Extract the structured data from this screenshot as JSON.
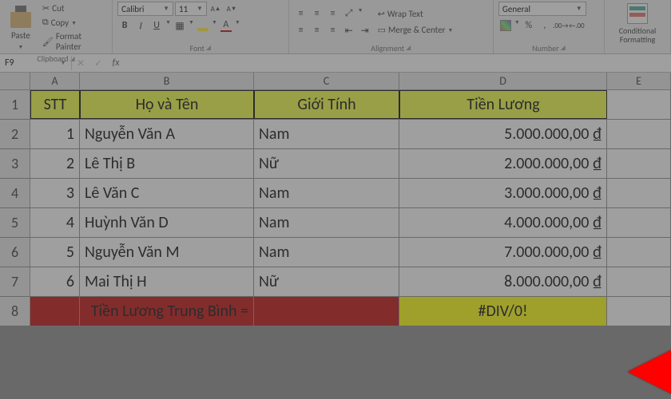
{
  "ribbon": {
    "clipboard": {
      "paste": "Paste",
      "cut": "Cut",
      "copy": "Copy",
      "painter": "Format Painter",
      "label": "Clipboard"
    },
    "font": {
      "name": "Calibri",
      "size": "11",
      "bold": "B",
      "italic": "I",
      "underline": "U",
      "fontcolor_letter": "A",
      "inc": "A▲",
      "dec": "A▼",
      "label": "Font"
    },
    "alignment": {
      "wrap": "Wrap Text",
      "merge": "Merge & Center",
      "label": "Alignment"
    },
    "number": {
      "format": "General",
      "pct": "%",
      "comma": ",",
      "label": "Number"
    },
    "styles": {
      "cf": "Conditional Formatting"
    }
  },
  "namebox": "F9",
  "fx": "fx",
  "formula": "",
  "columns": [
    "A",
    "B",
    "C",
    "D",
    "E"
  ],
  "headers": {
    "a": "STT",
    "b": "Họ và Tên",
    "c": "Giới Tính",
    "d": "Tiền Lương"
  },
  "rows": [
    {
      "n": "2",
      "a": "1",
      "b": "Nguyễn Văn A",
      "c": "Nam",
      "d": "5.000.000,00 ₫"
    },
    {
      "n": "3",
      "a": "2",
      "b": "Lê Thị B",
      "c": "Nữ",
      "d": "2.000.000,00 ₫"
    },
    {
      "n": "4",
      "a": "3",
      "b": "Lê Văn C",
      "c": "Nam",
      "d": "3.000.000,00 ₫"
    },
    {
      "n": "5",
      "a": "4",
      "b": "Huỳnh Văn D",
      "c": "Nam",
      "d": "4.000.000,00 ₫"
    },
    {
      "n": "6",
      "a": "5",
      "b": "Nguyễn Văn M",
      "c": "Nam",
      "d": "7.000.000,00 ₫"
    },
    {
      "n": "7",
      "a": "6",
      "b": "Mai Thị H",
      "c": "Nữ",
      "d": "8.000.000,00 ₫"
    }
  ],
  "avg": {
    "n": "8",
    "label": "Tiền Lương Trung Bình =",
    "value": "#DIV/0!"
  },
  "chart_data": {
    "type": "table",
    "title": "Tiền Lương",
    "columns": [
      "STT",
      "Họ và Tên",
      "Giới Tính",
      "Tiền Lương"
    ],
    "rows": [
      [
        1,
        "Nguyễn Văn A",
        "Nam",
        5000000.0
      ],
      [
        2,
        "Lê Thị B",
        "Nữ",
        2000000.0
      ],
      [
        3,
        "Lê Văn C",
        "Nam",
        3000000.0
      ],
      [
        4,
        "Huỳnh Văn D",
        "Nam",
        4000000.0
      ],
      [
        5,
        "Nguyễn Văn M",
        "Nam",
        7000000.0
      ],
      [
        6,
        "Mai Thị H",
        "Nữ",
        8000000.0
      ]
    ],
    "summary": {
      "label": "Tiền Lương Trung Bình =",
      "value": "#DIV/0!"
    }
  }
}
